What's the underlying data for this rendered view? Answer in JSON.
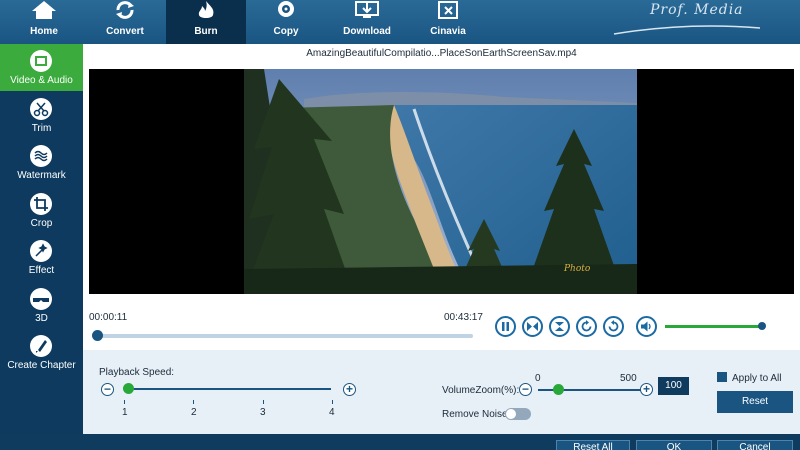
{
  "toolbar": {
    "tabs": [
      {
        "label": "Home",
        "icon": "home-icon"
      },
      {
        "label": "Convert",
        "icon": "convert-icon"
      },
      {
        "label": "Burn",
        "icon": "flame-icon",
        "active": true
      },
      {
        "label": "Copy",
        "icon": "disc-icon"
      },
      {
        "label": "Download",
        "icon": "download-monitor-icon"
      },
      {
        "label": "Cinavia",
        "icon": "cinavia-icon"
      }
    ],
    "brand": "Prof. Media"
  },
  "sidebar": {
    "items": [
      {
        "label": "Video & Audio",
        "icon": "film-icon",
        "active": true
      },
      {
        "label": "Trim",
        "icon": "scissors-icon"
      },
      {
        "label": "Watermark",
        "icon": "watermark-icon"
      },
      {
        "label": "Crop",
        "icon": "crop-icon"
      },
      {
        "label": "Effect",
        "icon": "effect-icon"
      },
      {
        "label": "3D",
        "icon": "3d-glasses-icon"
      },
      {
        "label": "Create Chapter",
        "icon": "chapter-icon"
      }
    ]
  },
  "player": {
    "filename": "AmazingBeautifulCompilatio...PlaceSonEarthScreenSav.mp4",
    "current_time": "00:00:11",
    "total_time": "00:43:17",
    "progress_percent": 0.4,
    "volume_percent": 100
  },
  "options": {
    "playback_speed_label": "Playback Speed:",
    "speed_ticks": [
      "1",
      "2",
      "3",
      "4"
    ],
    "speed_value": 1,
    "volume_zoom_label": "VolumeZoom(%):",
    "zoom_min": "0",
    "zoom_max": "500",
    "zoom_value": "100",
    "remove_noise_label": "Remove Noise:",
    "remove_noise_on": false,
    "apply_to_all_label": "Apply to All",
    "reset_label": "Reset"
  },
  "bottom": {
    "reset_all": "Reset All",
    "ok": "OK",
    "cancel": "Cancel"
  }
}
